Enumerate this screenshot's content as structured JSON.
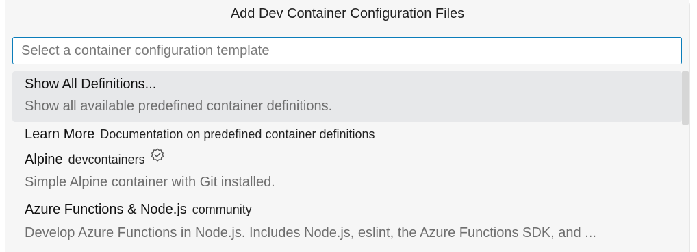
{
  "dialog": {
    "title": "Add Dev Container Configuration Files"
  },
  "search": {
    "placeholder": "Select a container configuration template",
    "value": ""
  },
  "items": [
    {
      "label": "Show All Definitions...",
      "description": "Show all available predefined container definitions.",
      "selected": true
    },
    {
      "label": "Learn More",
      "detail": "Documentation on predefined container definitions"
    },
    {
      "label": "Alpine",
      "detail": "devcontainers",
      "icon": "verified-badge-icon",
      "description": "Simple Alpine container with Git installed."
    },
    {
      "label": "Azure Functions & Node.js",
      "detail": "community",
      "description": "Develop Azure Functions in Node.js. Includes Node.js, eslint, the Azure Functions SDK, and ..."
    }
  ]
}
